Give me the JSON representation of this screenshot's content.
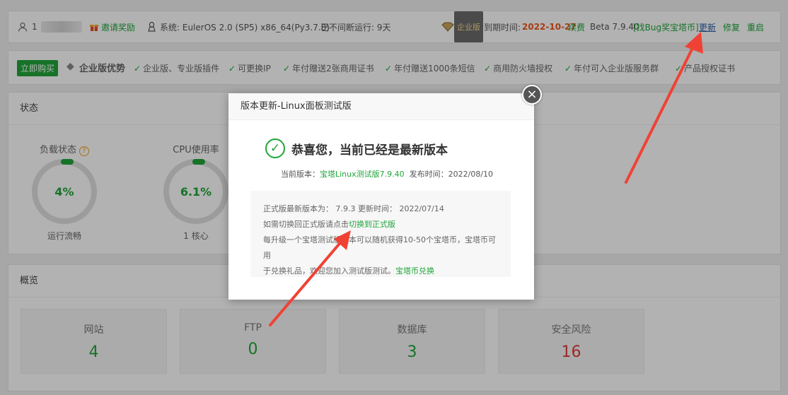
{
  "topbar": {
    "username_prefix": "1",
    "invite": "邀请奖励",
    "system": "系统:  EulerOS 2.0 (SP5) x86_64(Py3.7.8)",
    "uptime": "已不间断运行: 9天",
    "ent_badge": "企业版",
    "expire_label": "到期时间:",
    "expire_date": "2022-10-27",
    "renew": "续费",
    "version": "Beta 7.9.40",
    "bug": "[找Bug奖宝塔币]",
    "update": "更新",
    "repair": "修复",
    "restart": "重启"
  },
  "promo": {
    "buy": "立即购买",
    "title": "企业版优势",
    "features": [
      "企业版、专业版插件",
      "可更换IP",
      "年付赠送2张商用证书",
      "年付赠送1000条短信",
      "商用防火墙授权",
      "年付可入企业版服务群",
      "产品授权证书"
    ]
  },
  "status": {
    "title": "状态",
    "gauges": [
      {
        "label": "负载状态",
        "value": "4%",
        "sub": "运行流畅",
        "fraction": 0.04
      },
      {
        "label": "CPU使用率",
        "value": "6.1%",
        "sub": "1 核心",
        "fraction": 0.061
      }
    ]
  },
  "overview": {
    "title": "概览",
    "cards": [
      {
        "name": "网站",
        "value": "4"
      },
      {
        "name": "FTP",
        "value": "0"
      },
      {
        "name": "数据库",
        "value": "3"
      },
      {
        "name": "安全风险",
        "value": "16"
      }
    ]
  },
  "dialog": {
    "title": "版本更新-Linux面板测试版",
    "close": "×",
    "success_msg": "恭喜您，当前已经是最新版本",
    "current_label": "当前版本：",
    "current_version": "宝塔Linux测试版7.9.40",
    "release_label": "发布时间：",
    "release_date": "2022/08/10",
    "line1": "正式版最新版本为：  7.9.3    更新时间：  2022/07/14",
    "line2_prefix": "如需切换回正式版请点击",
    "line2_link": "切换到正式版",
    "line3": "每升级一个宝塔测试版版本可以随机获得10-50个宝塔币，宝塔币可用",
    "line4_prefix": "于兑换礼品，欢迎您加入测试版测试。",
    "line4_link": "宝塔币兑换"
  },
  "colors": {
    "accent": "#20a53a",
    "danger": "#e03a3a",
    "expire": "#f0551e",
    "arrow": "#ef4235"
  }
}
